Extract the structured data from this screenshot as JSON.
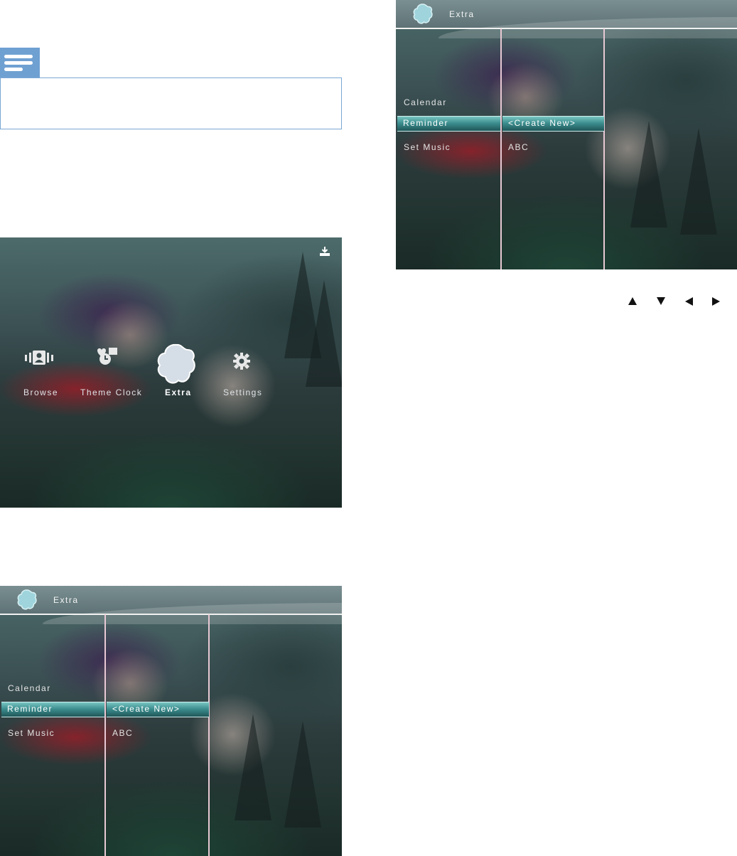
{
  "home": {
    "items": [
      {
        "label": "Browse",
        "icon": "browse-icon",
        "selected": false
      },
      {
        "label": "Theme Clock",
        "icon": "theme-clock-icon",
        "selected": false
      },
      {
        "label": "Extra",
        "icon": "extra-icon",
        "selected": true
      },
      {
        "label": "Settings",
        "icon": "settings-icon",
        "selected": false
      }
    ],
    "corner_icon": "download-icon"
  },
  "extra_screen": {
    "title": "Extra",
    "menu": [
      "Calendar",
      "Reminder",
      "Set Music"
    ],
    "selected_menu": "Reminder",
    "submenu": [
      "<Create New>",
      "ABC"
    ],
    "selected_submenu": "<Create New>"
  },
  "note_icon": "note-icon",
  "nav_arrows": [
    "arrow-up-icon",
    "arrow-down-icon",
    "arrow-left-icon",
    "arrow-right-icon"
  ],
  "colors": {
    "note_blue": "#6fa0d2",
    "highlight_teal": "#3d8f90",
    "divider_pink": "#e8c9d4"
  }
}
